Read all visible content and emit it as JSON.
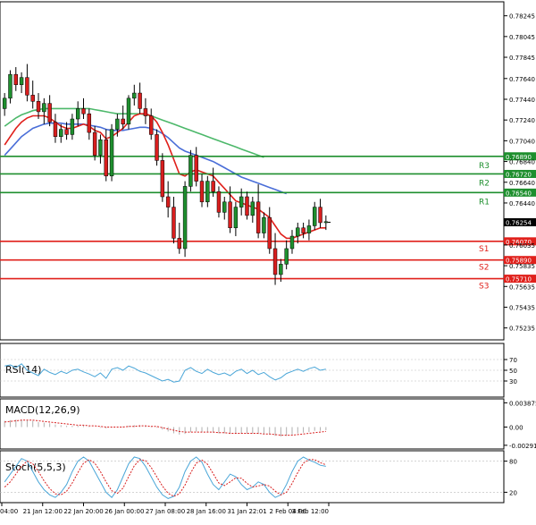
{
  "chart_data": {
    "type": "candlestick",
    "instrument": "",
    "price_axis": {
      "ticks": [
        "0.78245",
        "0.78045",
        "0.77845",
        "0.77640",
        "0.77440",
        "0.77240",
        "0.77040",
        "0.76840",
        "0.76640",
        "0.76440",
        "0.76035",
        "0.75835",
        "0.75635",
        "0.75435",
        "0.75235"
      ],
      "range": [
        0.7512,
        0.7838
      ]
    },
    "time_axis": {
      "labels": [
        "04:00",
        "21 Jan 12:00",
        "22 Jan 20:00",
        "26 Jan 00:00",
        "27 Jan 08:00",
        "28 Jan 16:00",
        "31 Jan 22:01",
        "2 Feb 04:00",
        "3 Feb 12:00"
      ]
    },
    "current_price": {
      "value": 0.76254,
      "label": "0.76254"
    },
    "levels": [
      {
        "name": "R3",
        "value": 0.7689,
        "label": "0.76890",
        "color": "#1e8f2e"
      },
      {
        "name": "R2",
        "value": 0.7672,
        "label": "0.76720",
        "color": "#1e8f2e"
      },
      {
        "name": "R1",
        "value": 0.7654,
        "label": "0.76540",
        "color": "#1e8f2e"
      },
      {
        "name": "S1",
        "value": 0.7607,
        "label": "0.76070",
        "color": "#e0201b"
      },
      {
        "name": "S2",
        "value": 0.7589,
        "label": "0.75890",
        "color": "#e0201b"
      },
      {
        "name": "S3",
        "value": 0.7571,
        "label": "0.75710",
        "color": "#e0201b"
      }
    ],
    "colors": {
      "bull": "#1e8f2e",
      "bear": "#d81e1e",
      "ma_fast": "#e0201b",
      "ma_mid": "#4a6ed8",
      "ma_slow": "#4cb86a",
      "osc": "#4aa6d8",
      "signal": "#d81e1e"
    },
    "candles": [
      [
        0.7735,
        0.775,
        0.7728,
        0.7745
      ],
      [
        0.7745,
        0.7772,
        0.774,
        0.7768
      ],
      [
        0.7768,
        0.7775,
        0.7752,
        0.7758
      ],
      [
        0.7758,
        0.777,
        0.775,
        0.7765
      ],
      [
        0.7765,
        0.7778,
        0.7742,
        0.7748
      ],
      [
        0.7748,
        0.7762,
        0.7735,
        0.7742
      ],
      [
        0.7742,
        0.775,
        0.7725,
        0.7732
      ],
      [
        0.7732,
        0.7745,
        0.772,
        0.774
      ],
      [
        0.774,
        0.7748,
        0.7718,
        0.7722
      ],
      [
        0.7722,
        0.773,
        0.7702,
        0.7708
      ],
      [
        0.7708,
        0.772,
        0.7702,
        0.7715
      ],
      [
        0.7715,
        0.7722,
        0.7705,
        0.771
      ],
      [
        0.771,
        0.773,
        0.7705,
        0.7725
      ],
      [
        0.7725,
        0.7742,
        0.7718,
        0.7735
      ],
      [
        0.7735,
        0.7745,
        0.7725,
        0.773
      ],
      [
        0.773,
        0.7735,
        0.7705,
        0.7712
      ],
      [
        0.7712,
        0.7718,
        0.7685,
        0.769
      ],
      [
        0.769,
        0.771,
        0.7682,
        0.7705
      ],
      [
        0.7705,
        0.7715,
        0.7665,
        0.767
      ],
      [
        0.767,
        0.772,
        0.7665,
        0.7715
      ],
      [
        0.7715,
        0.773,
        0.7708,
        0.7725
      ],
      [
        0.7725,
        0.7738,
        0.7715,
        0.772
      ],
      [
        0.772,
        0.7748,
        0.7715,
        0.7745
      ],
      [
        0.7745,
        0.7758,
        0.7738,
        0.775
      ],
      [
        0.775,
        0.776,
        0.773,
        0.7735
      ],
      [
        0.7735,
        0.7745,
        0.772,
        0.7728
      ],
      [
        0.7728,
        0.7735,
        0.7705,
        0.771
      ],
      [
        0.771,
        0.7715,
        0.768,
        0.7685
      ],
      [
        0.7685,
        0.7692,
        0.7645,
        0.765
      ],
      [
        0.765,
        0.7665,
        0.763,
        0.764
      ],
      [
        0.764,
        0.765,
        0.7605,
        0.761
      ],
      [
        0.761,
        0.7625,
        0.7595,
        0.76
      ],
      [
        0.76,
        0.7665,
        0.7592,
        0.766
      ],
      [
        0.766,
        0.7695,
        0.7655,
        0.769
      ],
      [
        0.769,
        0.7698,
        0.766,
        0.7665
      ],
      [
        0.7665,
        0.7672,
        0.764,
        0.7645
      ],
      [
        0.7645,
        0.767,
        0.764,
        0.7665
      ],
      [
        0.7665,
        0.7678,
        0.765,
        0.7655
      ],
      [
        0.7655,
        0.766,
        0.763,
        0.7635
      ],
      [
        0.7635,
        0.765,
        0.7628,
        0.7645
      ],
      [
        0.7645,
        0.766,
        0.7615,
        0.762
      ],
      [
        0.762,
        0.7645,
        0.7612,
        0.764
      ],
      [
        0.764,
        0.7658,
        0.7632,
        0.765
      ],
      [
        0.765,
        0.7655,
        0.7628,
        0.7632
      ],
      [
        0.7632,
        0.765,
        0.7625,
        0.7645
      ],
      [
        0.7645,
        0.7662,
        0.761,
        0.7615
      ],
      [
        0.7615,
        0.7635,
        0.761,
        0.763
      ],
      [
        0.763,
        0.764,
        0.7595,
        0.76
      ],
      [
        0.76,
        0.7615,
        0.7565,
        0.7575
      ],
      [
        0.7575,
        0.759,
        0.7568,
        0.7585
      ],
      [
        0.7585,
        0.7608,
        0.758,
        0.76
      ],
      [
        0.76,
        0.7618,
        0.7595,
        0.7612
      ],
      [
        0.7612,
        0.7625,
        0.7605,
        0.762
      ],
      [
        0.762,
        0.7625,
        0.761,
        0.7615
      ],
      [
        0.7615,
        0.7628,
        0.7608,
        0.7622
      ],
      [
        0.7622,
        0.7645,
        0.7618,
        0.764
      ],
      [
        0.764,
        0.7648,
        0.762,
        0.7625
      ],
      [
        0.7625,
        0.7632,
        0.7618,
        0.7626
      ]
    ],
    "ma_fast": [
      0.77,
      0.7708,
      0.7716,
      0.7722,
      0.7726,
      0.7728,
      0.7728,
      0.7728,
      0.7726,
      0.7722,
      0.7718,
      0.7716,
      0.7716,
      0.7718,
      0.772,
      0.7718,
      0.7714,
      0.7712,
      0.7706,
      0.7708,
      0.7712,
      0.7716,
      0.7722,
      0.7728,
      0.773,
      0.773,
      0.7728,
      0.7722,
      0.7712,
      0.77,
      0.7686,
      0.7672,
      0.767,
      0.7674,
      0.7676,
      0.7674,
      0.7672,
      0.767,
      0.7664,
      0.7658,
      0.7652,
      0.7646,
      0.7644,
      0.7642,
      0.764,
      0.7638,
      0.7634,
      0.763,
      0.7622,
      0.7614,
      0.761,
      0.761,
      0.7612,
      0.7614,
      0.7616,
      0.7618,
      0.762,
      0.762
    ],
    "ma_mid": [
      0.769,
      0.7696,
      0.7702,
      0.7708,
      0.7712,
      0.7716,
      0.7718,
      0.772,
      0.7721,
      0.7721,
      0.7721,
      0.772,
      0.772,
      0.772,
      0.772,
      0.7719,
      0.7718,
      0.7717,
      0.7715,
      0.7714,
      0.7714,
      0.7714,
      0.7715,
      0.7716,
      0.7717,
      0.7717,
      0.7716,
      0.7714,
      0.7711,
      0.7707,
      0.7702,
      0.7697,
      0.7694,
      0.7692,
      0.769,
      0.7688,
      0.7686,
      0.7684,
      0.7681,
      0.7678,
      0.7675,
      0.7672,
      0.7669,
      0.7667,
      0.7665,
      0.7663,
      0.7661,
      0.7659,
      0.7657,
      0.7655,
      0.7653
    ],
    "ma_slow": [
      0.7718,
      0.7722,
      0.7726,
      0.7729,
      0.7731,
      0.7733,
      0.7734,
      0.7735,
      0.7735,
      0.7735,
      0.7735,
      0.7735,
      0.7735,
      0.7735,
      0.7735,
      0.7735,
      0.7734,
      0.7733,
      0.7732,
      0.7731,
      0.773,
      0.773,
      0.773,
      0.773,
      0.773,
      0.7729,
      0.7728,
      0.7726,
      0.7724,
      0.7722,
      0.772,
      0.7718,
      0.7716,
      0.7714,
      0.7712,
      0.771,
      0.7708,
      0.7706,
      0.7704,
      0.7702,
      0.77,
      0.7698,
      0.7696,
      0.7694,
      0.7692,
      0.769,
      0.7688
    ],
    "rsi": {
      "label": "RSI(14)",
      "ticks": [
        "70",
        "50",
        "30"
      ],
      "range": [
        0,
        100
      ],
      "values": [
        58,
        60,
        55,
        62,
        50,
        45,
        40,
        52,
        46,
        42,
        48,
        44,
        50,
        52,
        47,
        43,
        38,
        45,
        35,
        52,
        55,
        50,
        58,
        54,
        48,
        45,
        40,
        35,
        30,
        33,
        28,
        30,
        50,
        55,
        48,
        44,
        52,
        46,
        42,
        45,
        40,
        48,
        52,
        44,
        50,
        42,
        46,
        38,
        32,
        36,
        44,
        48,
        52,
        48,
        53,
        56,
        50,
        52
      ]
    },
    "macd": {
      "label": "MACD(12,26,9)",
      "ticks": [
        "0.003875",
        "0.00",
        "-0.002911"
      ],
      "range": [
        -0.0035,
        0.0045
      ],
      "histogram": [
        0.001,
        0.0011,
        0.0012,
        0.0012,
        0.0011,
        0.001,
        0.0008,
        0.0007,
        0.0006,
        0.0004,
        0.0003,
        0.0002,
        0.0002,
        0.0002,
        0.0002,
        0.0001,
        0.0,
        -0.0001,
        -0.0002,
        -0.0001,
        0.0,
        0.0001,
        0.0002,
        0.0003,
        0.0003,
        0.0002,
        0.0001,
        -0.0001,
        -0.0004,
        -0.0007,
        -0.001,
        -0.0012,
        -0.0011,
        -0.0008,
        -0.0007,
        -0.0008,
        -0.0008,
        -0.0009,
        -0.001,
        -0.001,
        -0.0011,
        -0.0011,
        -0.001,
        -0.001,
        -0.001,
        -0.0011,
        -0.0011,
        -0.0012,
        -0.0014,
        -0.0015,
        -0.0014,
        -0.0012,
        -0.001,
        -0.0009,
        -0.0008,
        -0.0006,
        -0.0006,
        -0.0005
      ],
      "signal": [
        0.0008,
        0.0009,
        0.001,
        0.0011,
        0.0011,
        0.0011,
        0.001,
        0.0009,
        0.0008,
        0.0007,
        0.0006,
        0.0005,
        0.0004,
        0.0003,
        0.0003,
        0.0002,
        0.0002,
        0.0001,
        0.0,
        0.0,
        0.0,
        0.0,
        0.0001,
        0.0001,
        0.0002,
        0.0002,
        0.0001,
        0.0001,
        -0.0001,
        -0.0003,
        -0.0005,
        -0.0007,
        -0.0008,
        -0.0008,
        -0.0008,
        -0.0008,
        -0.0008,
        -0.0008,
        -0.0009,
        -0.0009,
        -0.001,
        -0.001,
        -0.001,
        -0.001,
        -0.001,
        -0.001,
        -0.0011,
        -0.0011,
        -0.0012,
        -0.0013,
        -0.0013,
        -0.0013,
        -0.0012,
        -0.0011,
        -0.001,
        -0.0009,
        -0.0008,
        -0.0007
      ]
    },
    "stoch": {
      "label": "Stoch(5,5,3)",
      "ticks": [
        "80",
        "20"
      ],
      "range": [
        0,
        100
      ],
      "k": [
        40,
        55,
        70,
        85,
        80,
        60,
        40,
        25,
        15,
        10,
        20,
        35,
        60,
        80,
        88,
        80,
        60,
        40,
        20,
        10,
        25,
        50,
        75,
        88,
        85,
        70,
        50,
        30,
        15,
        8,
        12,
        30,
        60,
        80,
        88,
        78,
        55,
        35,
        25,
        40,
        55,
        50,
        35,
        25,
        30,
        40,
        35,
        20,
        10,
        15,
        35,
        60,
        80,
        88,
        82,
        78,
        72,
        70
      ],
      "d": [
        30,
        40,
        55,
        70,
        80,
        75,
        60,
        42,
        27,
        17,
        15,
        22,
        38,
        58,
        76,
        83,
        76,
        60,
        40,
        23,
        18,
        28,
        50,
        71,
        83,
        81,
        68,
        50,
        32,
        18,
        12,
        17,
        34,
        57,
        76,
        82,
        74,
        56,
        38,
        33,
        40,
        48,
        47,
        37,
        30,
        32,
        35,
        32,
        22,
        15,
        20,
        37,
        58,
        76,
        83,
        83,
        77,
        73
      ]
    }
  }
}
